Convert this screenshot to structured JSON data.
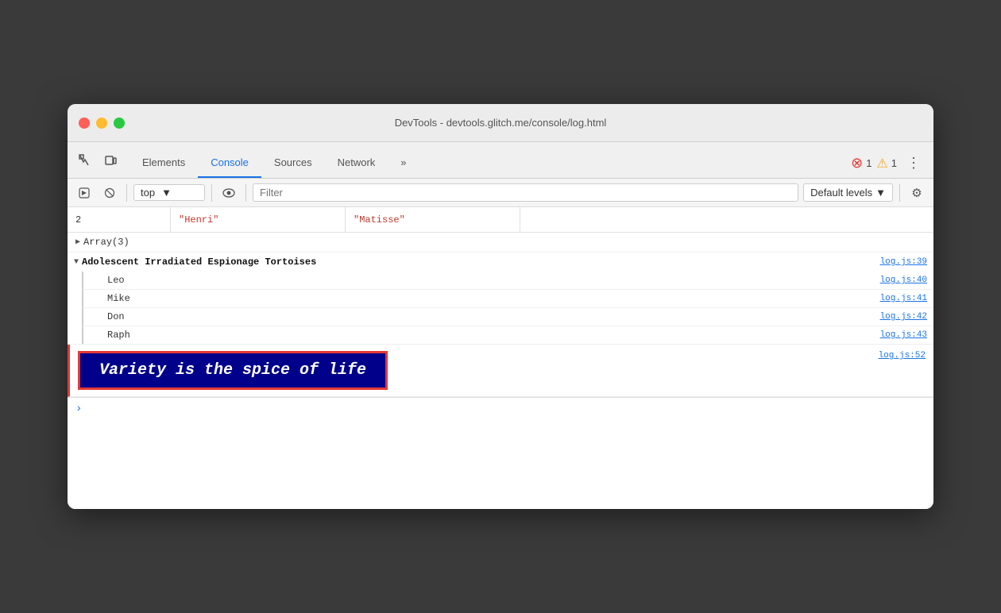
{
  "window": {
    "title": "DevTools - devtools.glitch.me/console/log.html"
  },
  "tabs": {
    "items": [
      {
        "id": "elements",
        "label": "Elements",
        "active": false
      },
      {
        "id": "console",
        "label": "Console",
        "active": true
      },
      {
        "id": "sources",
        "label": "Sources",
        "active": false
      },
      {
        "id": "network",
        "label": "Network",
        "active": false
      },
      {
        "id": "more",
        "label": "»",
        "active": false
      }
    ],
    "error_count": "1",
    "warn_count": "1"
  },
  "toolbar": {
    "context": "top",
    "filter_placeholder": "Filter",
    "levels_label": "Default levels"
  },
  "console": {
    "table_row": {
      "index": "2",
      "first_name": "\"Henri\"",
      "last_name": "\"Matisse\""
    },
    "array_label": "▶ Array(3)",
    "group_label": "Adolescent Irradiated Espionage Tortoises",
    "group_ref": "log.js:39",
    "items": [
      {
        "name": "Leo",
        "ref": "log.js:40"
      },
      {
        "name": "Mike",
        "ref": "log.js:41"
      },
      {
        "name": "Don",
        "ref": "log.js:42"
      },
      {
        "name": "Raph",
        "ref": "log.js:43"
      }
    ],
    "styled_ref": "log.js:52",
    "styled_text": "Variety is the spice of life"
  }
}
